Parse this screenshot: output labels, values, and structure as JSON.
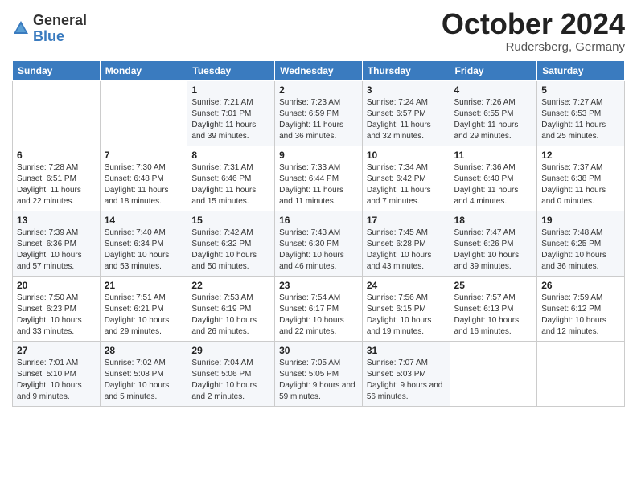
{
  "logo": {
    "general": "General",
    "blue": "Blue"
  },
  "title": "October 2024",
  "location": "Rudersberg, Germany",
  "days_of_week": [
    "Sunday",
    "Monday",
    "Tuesday",
    "Wednesday",
    "Thursday",
    "Friday",
    "Saturday"
  ],
  "weeks": [
    [
      {
        "day": "",
        "sunrise": "",
        "sunset": "",
        "daylight": ""
      },
      {
        "day": "",
        "sunrise": "",
        "sunset": "",
        "daylight": ""
      },
      {
        "day": "1",
        "sunrise": "Sunrise: 7:21 AM",
        "sunset": "Sunset: 7:01 PM",
        "daylight": "Daylight: 11 hours and 39 minutes."
      },
      {
        "day": "2",
        "sunrise": "Sunrise: 7:23 AM",
        "sunset": "Sunset: 6:59 PM",
        "daylight": "Daylight: 11 hours and 36 minutes."
      },
      {
        "day": "3",
        "sunrise": "Sunrise: 7:24 AM",
        "sunset": "Sunset: 6:57 PM",
        "daylight": "Daylight: 11 hours and 32 minutes."
      },
      {
        "day": "4",
        "sunrise": "Sunrise: 7:26 AM",
        "sunset": "Sunset: 6:55 PM",
        "daylight": "Daylight: 11 hours and 29 minutes."
      },
      {
        "day": "5",
        "sunrise": "Sunrise: 7:27 AM",
        "sunset": "Sunset: 6:53 PM",
        "daylight": "Daylight: 11 hours and 25 minutes."
      }
    ],
    [
      {
        "day": "6",
        "sunrise": "Sunrise: 7:28 AM",
        "sunset": "Sunset: 6:51 PM",
        "daylight": "Daylight: 11 hours and 22 minutes."
      },
      {
        "day": "7",
        "sunrise": "Sunrise: 7:30 AM",
        "sunset": "Sunset: 6:48 PM",
        "daylight": "Daylight: 11 hours and 18 minutes."
      },
      {
        "day": "8",
        "sunrise": "Sunrise: 7:31 AM",
        "sunset": "Sunset: 6:46 PM",
        "daylight": "Daylight: 11 hours and 15 minutes."
      },
      {
        "day": "9",
        "sunrise": "Sunrise: 7:33 AM",
        "sunset": "Sunset: 6:44 PM",
        "daylight": "Daylight: 11 hours and 11 minutes."
      },
      {
        "day": "10",
        "sunrise": "Sunrise: 7:34 AM",
        "sunset": "Sunset: 6:42 PM",
        "daylight": "Daylight: 11 hours and 7 minutes."
      },
      {
        "day": "11",
        "sunrise": "Sunrise: 7:36 AM",
        "sunset": "Sunset: 6:40 PM",
        "daylight": "Daylight: 11 hours and 4 minutes."
      },
      {
        "day": "12",
        "sunrise": "Sunrise: 7:37 AM",
        "sunset": "Sunset: 6:38 PM",
        "daylight": "Daylight: 11 hours and 0 minutes."
      }
    ],
    [
      {
        "day": "13",
        "sunrise": "Sunrise: 7:39 AM",
        "sunset": "Sunset: 6:36 PM",
        "daylight": "Daylight: 10 hours and 57 minutes."
      },
      {
        "day": "14",
        "sunrise": "Sunrise: 7:40 AM",
        "sunset": "Sunset: 6:34 PM",
        "daylight": "Daylight: 10 hours and 53 minutes."
      },
      {
        "day": "15",
        "sunrise": "Sunrise: 7:42 AM",
        "sunset": "Sunset: 6:32 PM",
        "daylight": "Daylight: 10 hours and 50 minutes."
      },
      {
        "day": "16",
        "sunrise": "Sunrise: 7:43 AM",
        "sunset": "Sunset: 6:30 PM",
        "daylight": "Daylight: 10 hours and 46 minutes."
      },
      {
        "day": "17",
        "sunrise": "Sunrise: 7:45 AM",
        "sunset": "Sunset: 6:28 PM",
        "daylight": "Daylight: 10 hours and 43 minutes."
      },
      {
        "day": "18",
        "sunrise": "Sunrise: 7:47 AM",
        "sunset": "Sunset: 6:26 PM",
        "daylight": "Daylight: 10 hours and 39 minutes."
      },
      {
        "day": "19",
        "sunrise": "Sunrise: 7:48 AM",
        "sunset": "Sunset: 6:25 PM",
        "daylight": "Daylight: 10 hours and 36 minutes."
      }
    ],
    [
      {
        "day": "20",
        "sunrise": "Sunrise: 7:50 AM",
        "sunset": "Sunset: 6:23 PM",
        "daylight": "Daylight: 10 hours and 33 minutes."
      },
      {
        "day": "21",
        "sunrise": "Sunrise: 7:51 AM",
        "sunset": "Sunset: 6:21 PM",
        "daylight": "Daylight: 10 hours and 29 minutes."
      },
      {
        "day": "22",
        "sunrise": "Sunrise: 7:53 AM",
        "sunset": "Sunset: 6:19 PM",
        "daylight": "Daylight: 10 hours and 26 minutes."
      },
      {
        "day": "23",
        "sunrise": "Sunrise: 7:54 AM",
        "sunset": "Sunset: 6:17 PM",
        "daylight": "Daylight: 10 hours and 22 minutes."
      },
      {
        "day": "24",
        "sunrise": "Sunrise: 7:56 AM",
        "sunset": "Sunset: 6:15 PM",
        "daylight": "Daylight: 10 hours and 19 minutes."
      },
      {
        "day": "25",
        "sunrise": "Sunrise: 7:57 AM",
        "sunset": "Sunset: 6:13 PM",
        "daylight": "Daylight: 10 hours and 16 minutes."
      },
      {
        "day": "26",
        "sunrise": "Sunrise: 7:59 AM",
        "sunset": "Sunset: 6:12 PM",
        "daylight": "Daylight: 10 hours and 12 minutes."
      }
    ],
    [
      {
        "day": "27",
        "sunrise": "Sunrise: 7:01 AM",
        "sunset": "Sunset: 5:10 PM",
        "daylight": "Daylight: 10 hours and 9 minutes."
      },
      {
        "day": "28",
        "sunrise": "Sunrise: 7:02 AM",
        "sunset": "Sunset: 5:08 PM",
        "daylight": "Daylight: 10 hours and 5 minutes."
      },
      {
        "day": "29",
        "sunrise": "Sunrise: 7:04 AM",
        "sunset": "Sunset: 5:06 PM",
        "daylight": "Daylight: 10 hours and 2 minutes."
      },
      {
        "day": "30",
        "sunrise": "Sunrise: 7:05 AM",
        "sunset": "Sunset: 5:05 PM",
        "daylight": "Daylight: 9 hours and 59 minutes."
      },
      {
        "day": "31",
        "sunrise": "Sunrise: 7:07 AM",
        "sunset": "Sunset: 5:03 PM",
        "daylight": "Daylight: 9 hours and 56 minutes."
      },
      {
        "day": "",
        "sunrise": "",
        "sunset": "",
        "daylight": ""
      },
      {
        "day": "",
        "sunrise": "",
        "sunset": "",
        "daylight": ""
      }
    ]
  ]
}
